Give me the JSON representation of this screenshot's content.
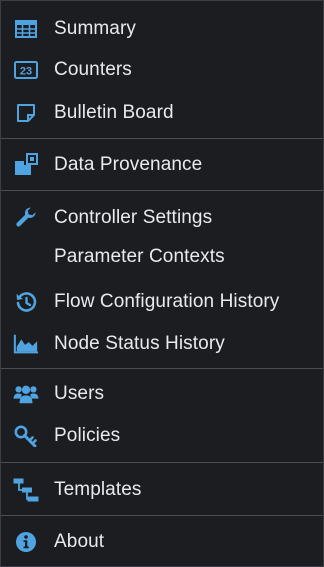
{
  "menu": {
    "accent_color": "#4fa3e0",
    "items": [
      {
        "label": "Summary",
        "icon": "table-icon"
      },
      {
        "label": "Counters",
        "icon": "counter-icon"
      },
      {
        "label": "Bulletin Board",
        "icon": "sticky-note-icon"
      },
      {
        "label": "Data Provenance",
        "icon": "provenance-icon"
      },
      {
        "label": "Controller Settings",
        "icon": "wrench-icon"
      },
      {
        "label": "Parameter Contexts",
        "icon": ""
      },
      {
        "label": "Flow Configuration History",
        "icon": "history-icon"
      },
      {
        "label": "Node Status History",
        "icon": "area-chart-icon"
      },
      {
        "label": "Users",
        "icon": "users-icon"
      },
      {
        "label": "Policies",
        "icon": "key-icon"
      },
      {
        "label": "Templates",
        "icon": "templates-icon"
      },
      {
        "label": "About",
        "icon": "info-icon"
      }
    ]
  }
}
